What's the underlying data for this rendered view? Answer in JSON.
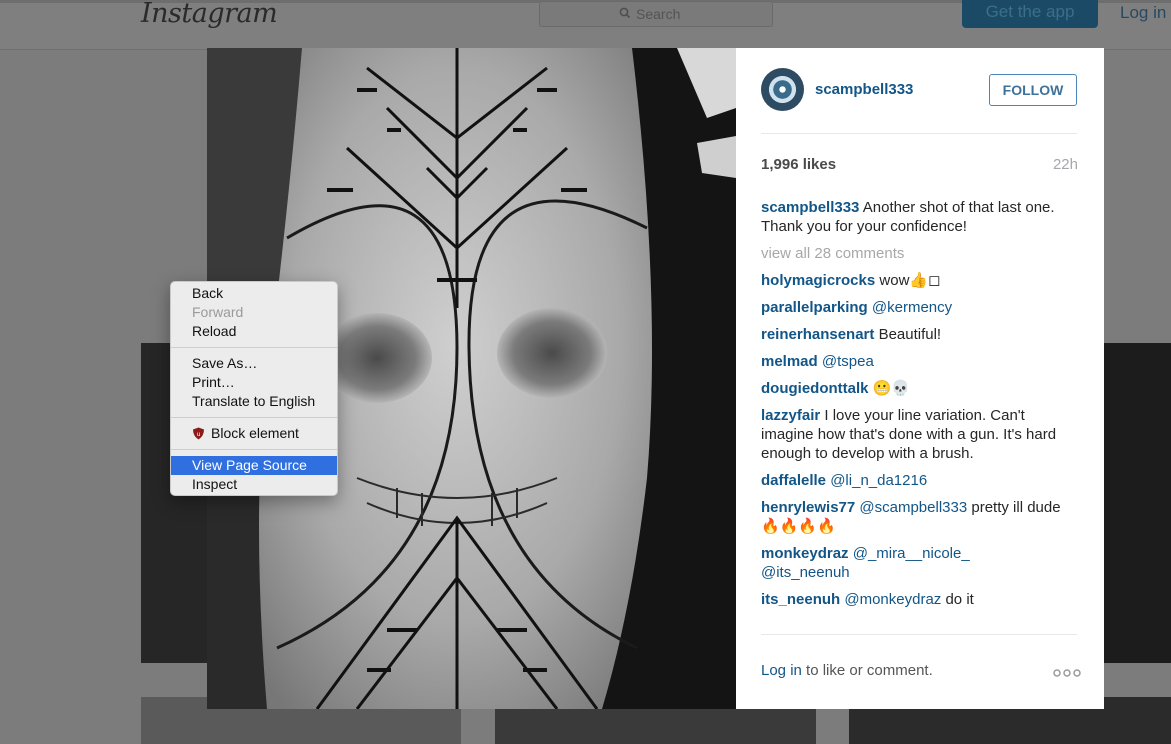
{
  "topbar": {
    "logo": "Instagram",
    "search_placeholder": "Search",
    "get_app": "Get the app",
    "login": "Log in"
  },
  "post": {
    "username": "scampbell333",
    "follow_label": "FOLLOW",
    "likes": "1,996 likes",
    "age": "22h",
    "caption_user": "scampbell333",
    "caption_line1": "Another shot of that last one.",
    "caption_line2": "Thank you for your confidence!",
    "view_all": "view all 28 comments",
    "comments": [
      {
        "user": "holymagicrocks",
        "mention": "",
        "text": "wow👍◻"
      },
      {
        "user": "parallelparking",
        "mention": "@kermency",
        "text": ""
      },
      {
        "user": "reinerhansenart",
        "mention": "",
        "text": "Beautiful!"
      },
      {
        "user": "melmad",
        "mention": "@tspea",
        "text": ""
      },
      {
        "user": "dougiedonttalk",
        "mention": "",
        "text": "😬💀"
      },
      {
        "user": "lazzyfair",
        "mention": "",
        "text": "I love your line variation. Can't imagine how that's done with a gun. It's hard enough to develop with a brush."
      },
      {
        "user": "daffalelle",
        "mention": "@li_n_da1216",
        "text": ""
      },
      {
        "user": "henrylewis77",
        "mention": "@scampbell333",
        "text": "pretty ill dude🔥🔥🔥🔥"
      },
      {
        "user": "monkeydraz",
        "mention": "@_mira__nicole_ @its_neenuh",
        "text": ""
      },
      {
        "user": "its_neenuh",
        "mention": "@monkeydraz",
        "text": "do it"
      }
    ],
    "login_link": "Log in",
    "login_suffix": " to like or comment."
  },
  "context_menu": {
    "items": [
      "Back",
      "Forward",
      "Reload",
      "Save As…",
      "Print…",
      "Translate to English",
      "Block element",
      "View Page Source",
      "Inspect"
    ]
  },
  "icons": [
    "search-icon",
    "ublock-icon",
    "more-options-icon"
  ],
  "colors": {
    "link": "#125688",
    "follow_border": "#4a87b8",
    "menu_highlight": "#2f6fdf"
  }
}
